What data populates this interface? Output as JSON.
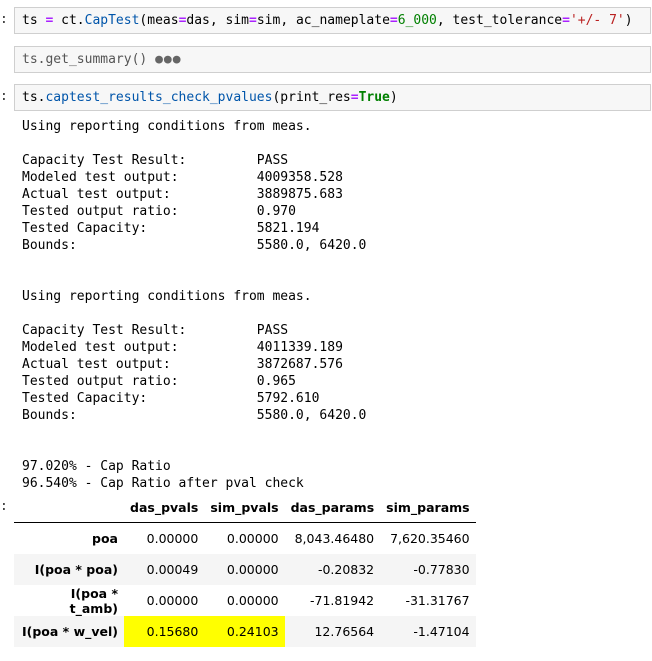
{
  "cells": [
    {
      "prompt": ":",
      "code": {
        "var": "ts",
        "op": "=",
        "module": "ct",
        "cls": "CapTest",
        "arg1_name": "meas",
        "arg1_val": "das",
        "arg2_name": "sim",
        "arg2_val": "sim",
        "arg3_name": "ac_nameplate",
        "arg3_val": "6_000",
        "arg4_name": "test_tolerance",
        "arg4_val": "'+/- 7'"
      }
    },
    {
      "prompt": "",
      "code": {
        "text": "ts.get_summary()",
        "ellipsis": "●●●"
      }
    },
    {
      "prompt": ":",
      "code": {
        "obj": "ts",
        "method": "captest_results_check_pvalues",
        "arg_name": "print_res",
        "arg_val": "True"
      }
    }
  ],
  "output_text": "Using reporting conditions from meas.\n\nCapacity Test Result:         PASS\nModeled test output:          4009358.528\nActual test output:           3889875.683\nTested output ratio:          0.970\nTested Capacity:              5821.194\nBounds:                       5580.0, 6420.0\n\n\nUsing reporting conditions from meas.\n\nCapacity Test Result:         PASS\nModeled test output:          4011339.189\nActual test output:           3872687.576\nTested output ratio:          0.965\nTested Capacity:              5792.610\nBounds:                       5580.0, 6420.0\n\n\n97.020% - Cap Ratio\n96.540% - Cap Ratio after pval check",
  "output_prompt": ":",
  "table": {
    "columns": [
      "das_pvals",
      "sim_pvals",
      "das_params",
      "sim_params"
    ],
    "rows": [
      {
        "label": "poa",
        "values": [
          "0.00000",
          "0.00000",
          "8,043.46480",
          "7,620.35460"
        ]
      },
      {
        "label": "I(poa * poa)",
        "values": [
          "0.00049",
          "0.00000",
          "-0.20832",
          "-0.77830"
        ]
      },
      {
        "label": "I(poa * t_amb)",
        "values": [
          "0.00000",
          "0.00000",
          "-71.81942",
          "-31.31767"
        ]
      },
      {
        "label": "I(poa * w_vel)",
        "values": [
          "0.15680",
          "0.24103",
          "12.76564",
          "-1.47104"
        ]
      }
    ],
    "highlight_color": "#ffff00"
  }
}
